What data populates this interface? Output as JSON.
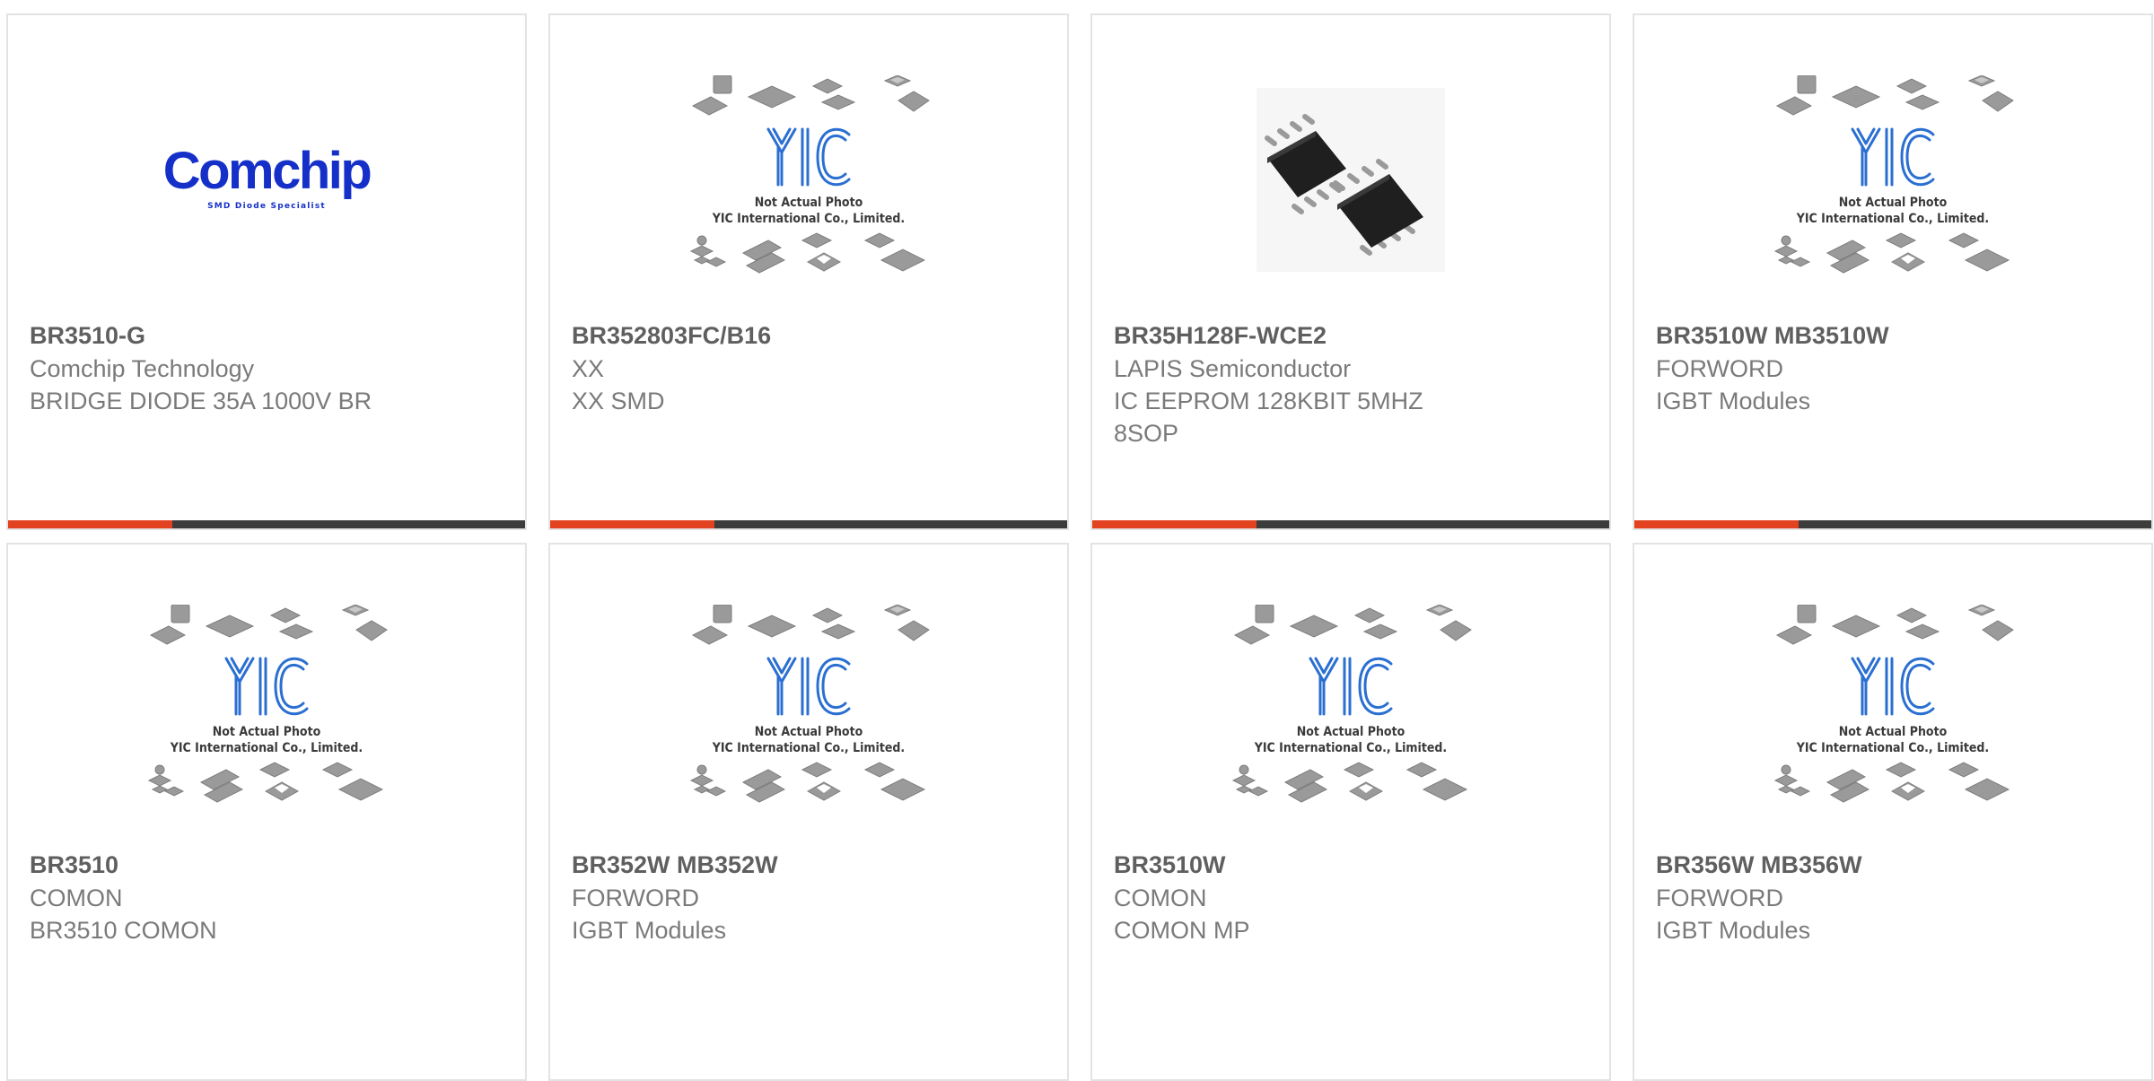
{
  "products": [
    {
      "part": "BR3510-G",
      "maker": "Comchip Technology",
      "desc": [
        "BRIDGE DIODE 35A 1000V BR"
      ],
      "image": "comchip-logo",
      "logo_text": "Comchip",
      "logo_tagline": "SMD Diode Specialist"
    },
    {
      "part": "BR352803FC/B16",
      "maker": "XX",
      "desc": [
        "XX SMD"
      ],
      "image": "yic-placeholder"
    },
    {
      "part": "BR35H128F-WCE2",
      "maker": "LAPIS Semiconductor",
      "desc": [
        "IC EEPROM 128KBIT 5MHZ",
        "8SOP"
      ],
      "image": "ic-chip-photo"
    },
    {
      "part": "BR3510W MB3510W",
      "maker": "FORWORD",
      "desc": [
        "IGBT Modules"
      ],
      "image": "yic-placeholder"
    },
    {
      "part": "BR3510",
      "maker": "COMON",
      "desc": [
        "BR3510 COMON"
      ],
      "image": "yic-placeholder"
    },
    {
      "part": "BR352W MB352W",
      "maker": "FORWORD",
      "desc": [
        "IGBT Modules"
      ],
      "image": "yic-placeholder"
    },
    {
      "part": "BR3510W",
      "maker": "COMON",
      "desc": [
        "COMON MP"
      ],
      "image": "yic-placeholder"
    },
    {
      "part": "BR356W MB356W",
      "maker": "FORWORD",
      "desc": [
        "IGBT Modules"
      ],
      "image": "yic-placeholder"
    }
  ],
  "placeholder": {
    "logo_text": "YIC",
    "line1": "Not Actual Photo",
    "line2": "YIC International Co., Limited."
  },
  "colors": {
    "accent": "#e2421f",
    "bar": "#3c3c3c",
    "comchip_blue": "#1530c8",
    "yic_blue": "#2a6fd1"
  }
}
